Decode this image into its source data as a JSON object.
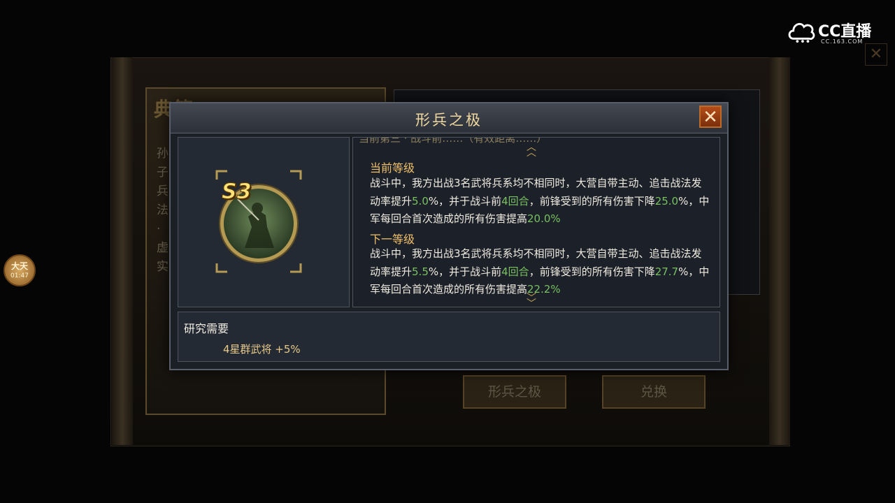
{
  "background": {
    "book_title": "典籍",
    "book_chars": [
      "孙",
      "子",
      "兵",
      "法",
      "·",
      "虚",
      "实"
    ],
    "buttons": [
      "形兵之极",
      "兑换"
    ],
    "close_glyph": "✕"
  },
  "overlay": {
    "cc_logo_text": "CC直播",
    "cc_logo_sub": "CC.163.COM",
    "side_bubble_title": "大天",
    "side_bubble_time": "01:47"
  },
  "modal": {
    "title": "形兵之极",
    "close_glyph": "✕",
    "badge": "S3",
    "top_cut_text": "当前第三 · 战斗前……（有效距离……）",
    "current_level": {
      "heading": "当前等级",
      "text_parts": [
        "战斗中，我方出战3名武将兵系均不相同时，大营自带主动、追击战法发动率提升",
        "5.0",
        "%，并于战斗前",
        "4回合",
        "，前锋受到的所有伤害下降",
        "25.0",
        "%，中军每回合首次造成的所有伤害提高",
        "20.0%"
      ]
    },
    "next_level": {
      "heading": "下一等级",
      "text_parts": [
        "战斗中，我方出战3名武将兵系均不相同时，大营自带主动、追击战法发动率提升",
        "5.5",
        "%，并于战斗前",
        "4回合",
        "，前锋受到的所有伤害下降",
        "27.7",
        "%，中军每回合首次造成的所有伤害提高",
        "22.2%"
      ]
    },
    "requirement": {
      "heading": "研究需要",
      "item": "4星群武将  +5%"
    }
  },
  "colors": {
    "highlight_green": "#78c060",
    "heading_gold": "#f0bf6a",
    "close_orange": "#b34d18"
  }
}
